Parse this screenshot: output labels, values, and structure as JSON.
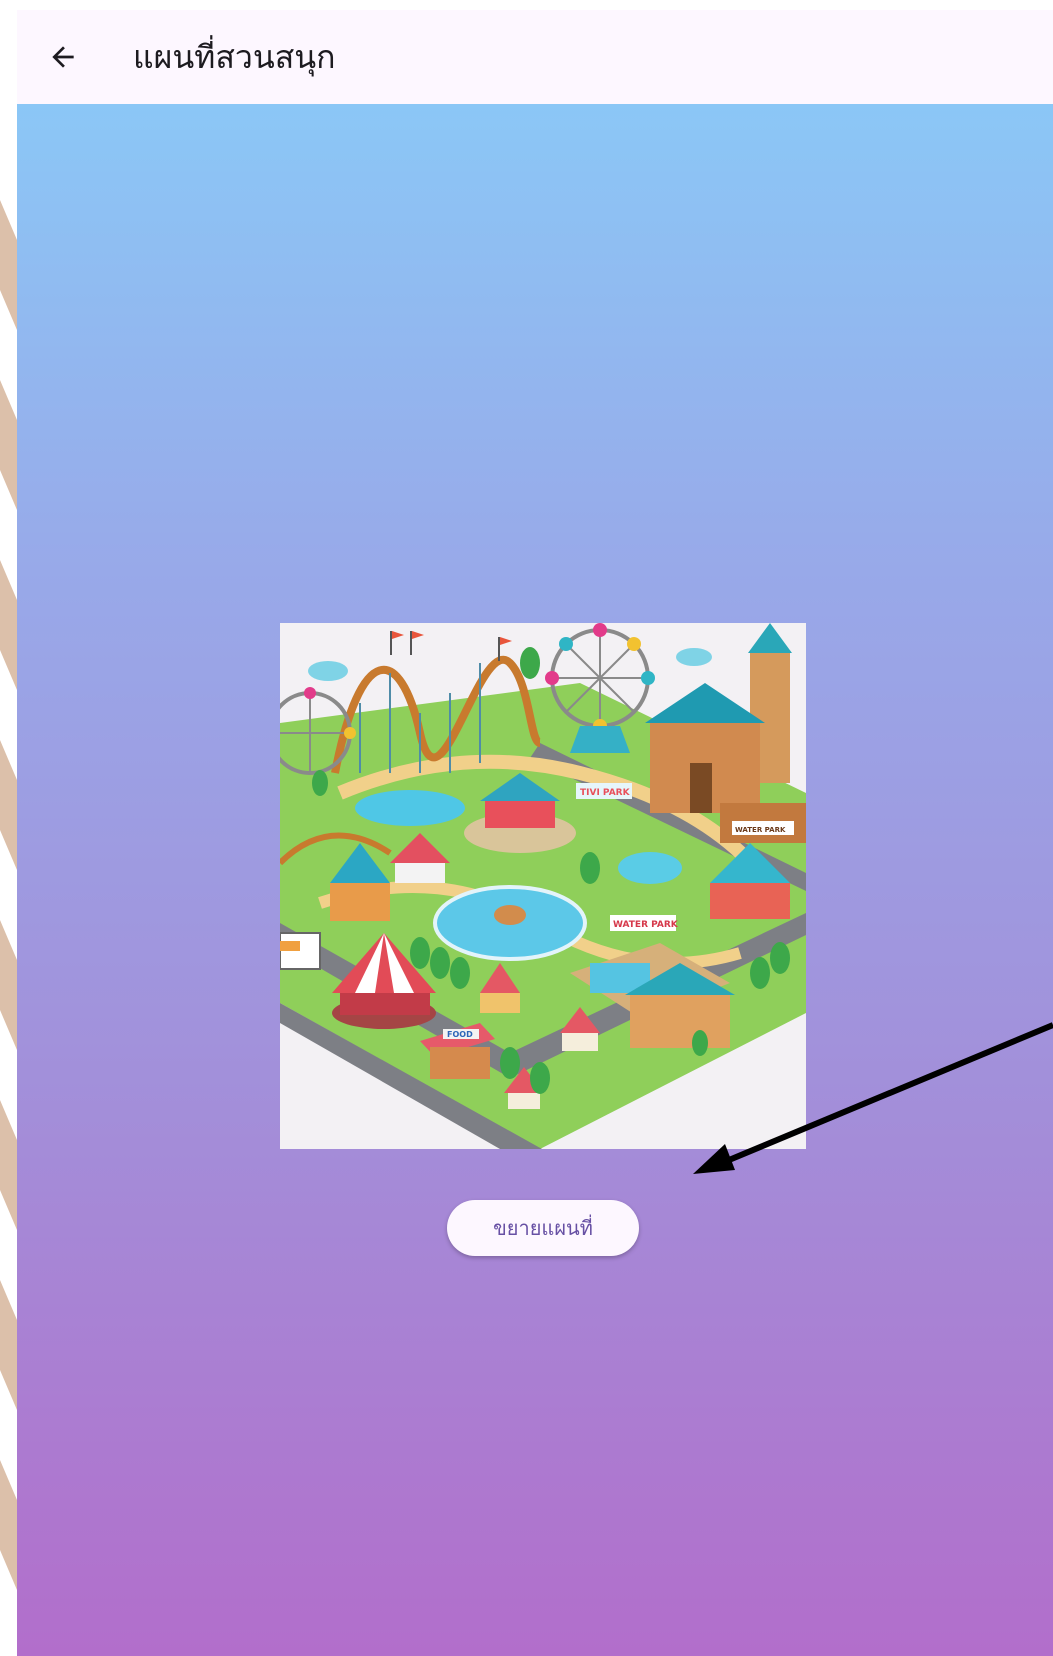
{
  "app_bar": {
    "title": "แผนที่สวนสนุก",
    "back_icon": "arrow-back-icon"
  },
  "map": {
    "image": "amusement-park-map-illustration",
    "signs": {
      "park": "TIVI PARK",
      "water_park": "WATER PARK",
      "water_park_side": "WATER PARK",
      "food": "FOOD"
    }
  },
  "expand_button": {
    "label": "ขยายแผนที่"
  },
  "annotation": {
    "type": "arrow",
    "color": "#000000",
    "points_to": "expand-map-button"
  },
  "colors": {
    "app_bar_bg": "#fdf7ff",
    "gradient_top": "#8bc7f6",
    "gradient_bottom": "#b26ecb",
    "button_text": "#6750a4",
    "left_deco_tan": "#dcc0aa"
  }
}
